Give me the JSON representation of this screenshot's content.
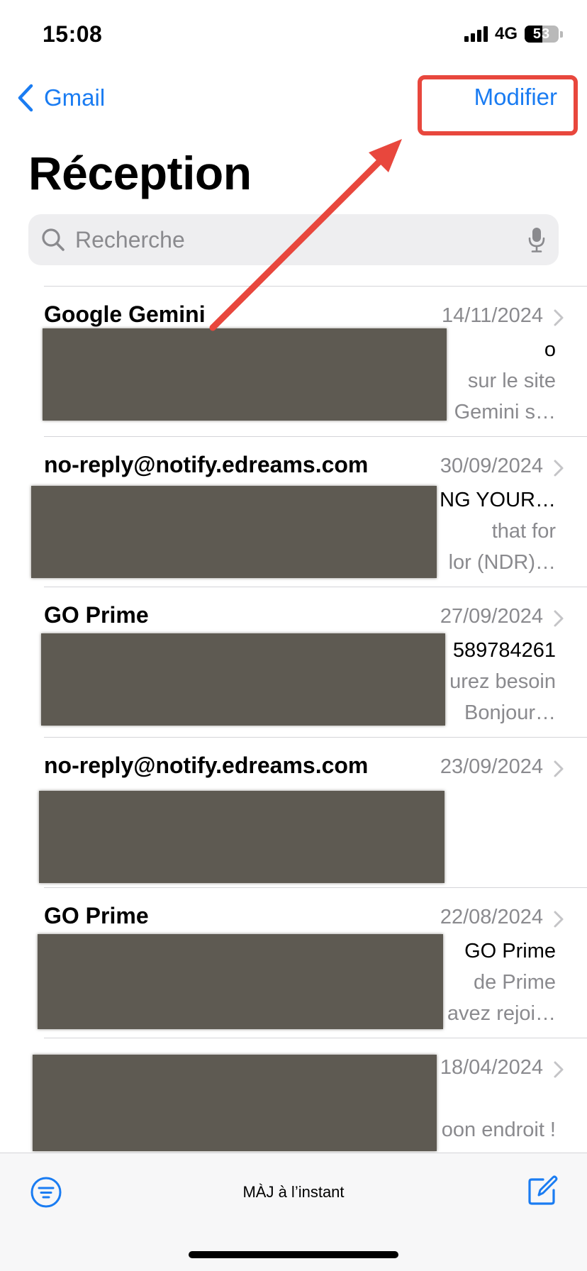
{
  "status_bar": {
    "time": "15:08",
    "network": "4G",
    "battery": "53"
  },
  "nav": {
    "back_label": "Gmail",
    "edit_label": "Modifier"
  },
  "page_title": "Réception",
  "search": {
    "placeholder": "Recherche"
  },
  "emails": [
    {
      "sender": "Google Gemini",
      "date": "14/11/2024",
      "subject": "o",
      "preview1": "sur le site",
      "preview2": "Gemini s…"
    },
    {
      "sender": "no-reply@notify.edreams.com",
      "date": "30/09/2024",
      "subject": "NG YOUR…",
      "preview1": "that for",
      "preview2": "lor (NDR)…"
    },
    {
      "sender": "GO Prime",
      "date": "27/09/2024",
      "subject": "589784261",
      "preview1": "urez besoin",
      "preview2": "Bonjour…"
    },
    {
      "sender": "no-reply@notify.edreams.com",
      "date": "23/09/2024",
      "subject": "",
      "preview1": "",
      "preview2": ""
    },
    {
      "sender": "GO Prime",
      "date": "22/08/2024",
      "subject": "GO Prime",
      "preview1": "de Prime",
      "preview2": "avez rejoi…"
    },
    {
      "sender": "",
      "date": "18/04/2024",
      "subject": "",
      "preview1": "",
      "preview2": "oon endroit !"
    }
  ],
  "toolbar": {
    "update_status": "MÀJ à l’instant"
  },
  "colors": {
    "accent": "#1a7cf2",
    "annotation": "#e8473d",
    "redaction": "#5e5a52",
    "secondary_text": "#8a8a8e"
  },
  "icons": {
    "back": "chevron-left-icon",
    "search": "magnifier-icon",
    "mic": "microphone-icon",
    "filter": "filter-icon",
    "compose": "compose-icon",
    "disclosure": "chevron-right-icon"
  }
}
